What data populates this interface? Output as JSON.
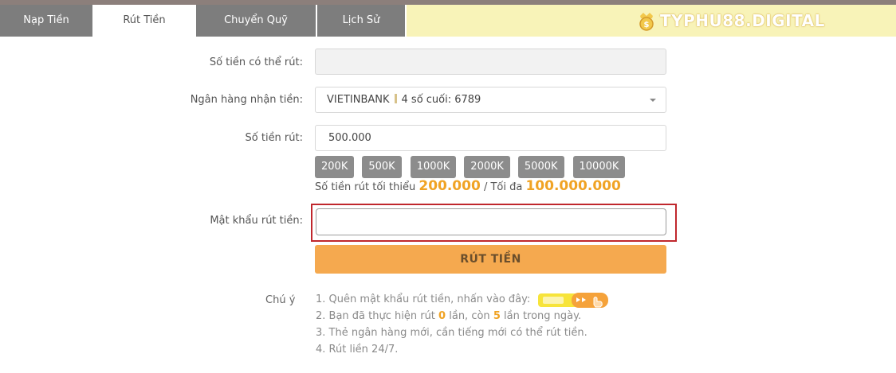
{
  "tabs": [
    {
      "label": "Nạp Tiền",
      "active": false
    },
    {
      "label": "Rút Tiền",
      "active": true
    },
    {
      "label": "Chuyển Quỹ",
      "active": false
    },
    {
      "label": "Lịch Sử",
      "active": false
    }
  ],
  "brand": {
    "text": "TYPHU88.DIGITAL"
  },
  "form": {
    "available_label": "Số tiền có thể rút:",
    "available_value": "",
    "bank_label": "Ngân hàng nhận tiền:",
    "bank_name": "VIETINBANK",
    "bank_last4": "4 số cuối: 6789",
    "amount_label": "Số tiền rút:",
    "amount_value": "500.000",
    "chips": [
      "200K",
      "500K",
      "1000K",
      "2000K",
      "5000K",
      "10000K"
    ],
    "limit_prefix": "Số tiền rút tối thiểu",
    "limit_min": "200.000",
    "limit_mid": "/ Tối đa",
    "limit_max": "100.000.000",
    "password_label": "Mật khẩu rút tiền:",
    "password_value": "",
    "submit_label": "RÚT TIỀN"
  },
  "notes": {
    "label": "Chú ý",
    "line1": "1. Quên mật khẩu rút tiền, nhấn vào đây:",
    "line2_a": "2. Bạn đã thực hiện rút",
    "line2_count": "0",
    "line2_b": "lần, còn",
    "line2_remaining": "5",
    "line2_c": "lần trong ngày.",
    "line3": "3. Thẻ ngân hàng mới, cần tiếng mới có thể rút tiền.",
    "line4": "4. Rút liền 24/7."
  },
  "colors": {
    "accent": "#f5a94f",
    "highlight": "#f0a324",
    "alert_border": "#c0272d",
    "tab_bg": "#7d7d7d"
  }
}
